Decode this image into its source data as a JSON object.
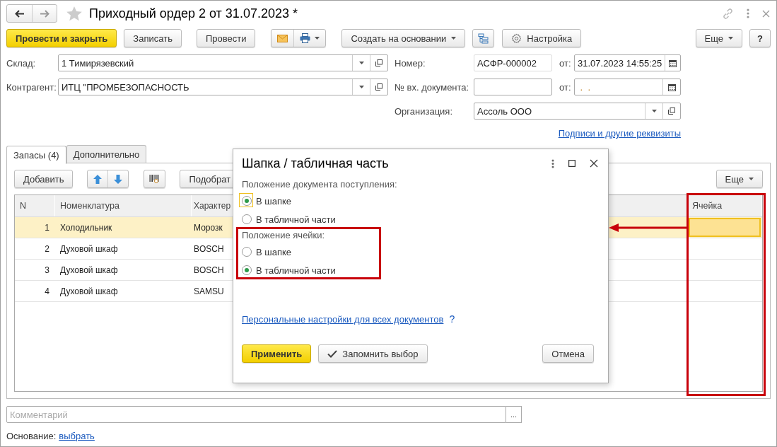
{
  "window": {
    "title": "Приходный ордер 2 от 31.07.2023 *"
  },
  "toolbar": {
    "buttons": [
      {
        "kind": "primary",
        "label": "Провести и закрыть"
      },
      {
        "kind": "text",
        "label": "Записать"
      },
      {
        "kind": "text",
        "label": "Провести"
      },
      {
        "kind": "mail-print"
      },
      {
        "kind": "dropdown",
        "label": "Создать на основании"
      },
      {
        "kind": "structure"
      },
      {
        "kind": "settings",
        "label": "Настройка"
      }
    ],
    "more": "Еще",
    "help": "?"
  },
  "left_fields": [
    {
      "label": "Склад:",
      "value": "1 Тимирязевский"
    },
    {
      "label": "Контрагент:",
      "value": "ИТЦ \"ПРОМБЕЗОПАСНОСТЬ"
    }
  ],
  "number": {
    "label": "Номер:",
    "value": "АСФР-000002",
    "date_label": "от:",
    "date": "31.07.2023 14:55:25"
  },
  "incoming": {
    "label": "№ вх. документа:",
    "date_label": "от:",
    "date": " .  ."
  },
  "organization": {
    "label": "Организация:",
    "value": "Ассоль ООО"
  },
  "details_link": "Подписи и другие реквизиты",
  "tabs": [
    {
      "label": "Запасы (4)",
      "selected": true
    },
    {
      "label": "Дополнительно",
      "selected": false
    }
  ],
  "table_toolbar": {
    "add": "Добавить",
    "pick": "Подобрат",
    "more": "Еще"
  },
  "table": {
    "columns": [
      "N",
      "Номенклатура",
      "Характер",
      "Ячейка"
    ],
    "rows": [
      {
        "n": "1",
        "item": "Холодильник",
        "column_3": "Морозк",
        "selected": true
      },
      {
        "n": "2",
        "item": "Духовой шкаф",
        "column_3": "BOSCH",
        "selected": false
      },
      {
        "n": "3",
        "item": "Духовой шкаф",
        "column_3": "BOSCH",
        "selected": false
      },
      {
        "n": "4",
        "item": "Духовой шкаф",
        "column_3": "SAMSU",
        "selected": false
      }
    ]
  },
  "comment": {
    "placeholder": "Комментарий",
    "button": "..."
  },
  "basis": {
    "label": "Основание:",
    "link": "выбрать"
  },
  "dialog": {
    "title": "Шапка / табличная часть",
    "groups": [
      {
        "label": "Положение документа поступления:",
        "options": [
          {
            "label": "В шапке",
            "selected": true,
            "focused": true
          },
          {
            "label": "В табличной части",
            "selected": false,
            "focused": false
          }
        ]
      },
      {
        "label": "Положение ячейки:",
        "options": [
          {
            "label": "В шапке",
            "selected": false,
            "focused": false
          },
          {
            "label": "В табличной части",
            "selected": true,
            "focused": false
          }
        ]
      }
    ],
    "link": "Персональные настройки для всех документов",
    "help": "?",
    "buttons": [
      {
        "kind": "primary",
        "label": "Применить"
      },
      {
        "kind": "check",
        "label": "Запомнить выбор"
      },
      {
        "kind": "text",
        "label": "Отмена"
      }
    ]
  }
}
